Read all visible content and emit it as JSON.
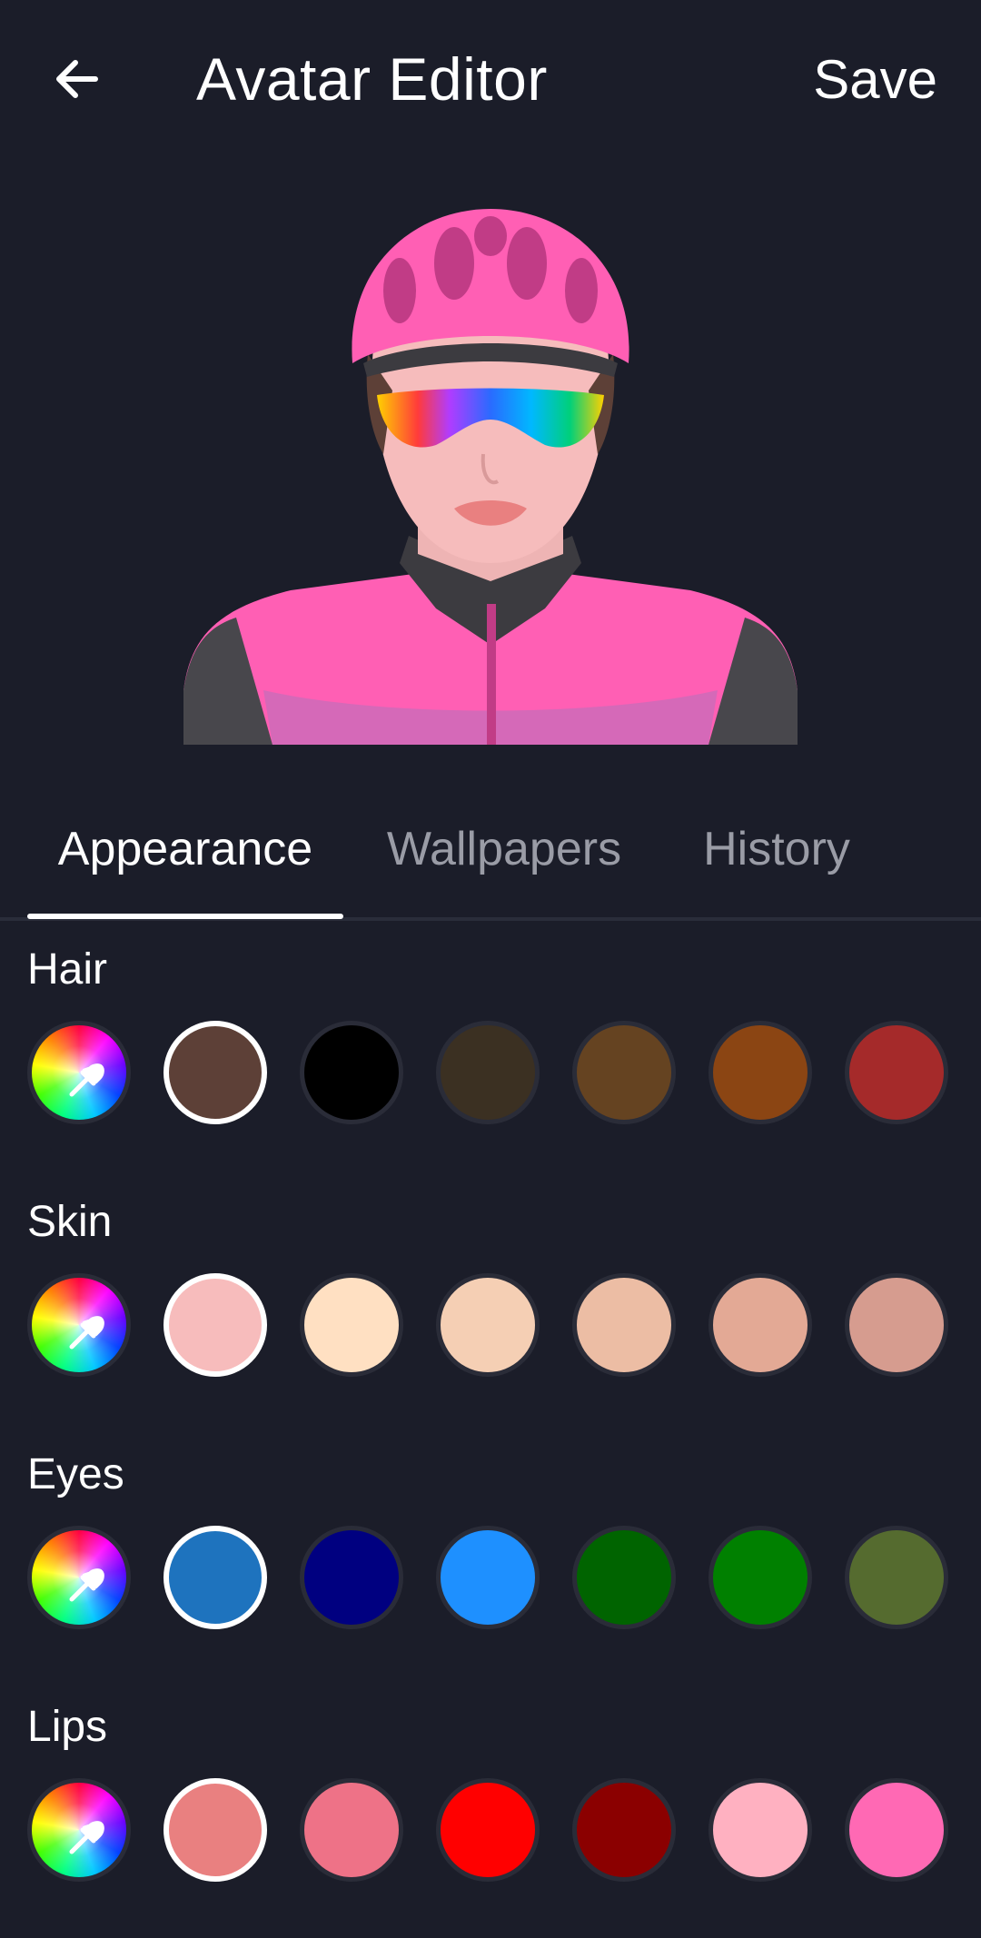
{
  "header": {
    "title": "Avatar Editor",
    "save_label": "Save",
    "back_icon": "arrow-left-icon"
  },
  "tabs": [
    {
      "label": "Appearance",
      "active": true
    },
    {
      "label": "Wallpapers",
      "active": false
    },
    {
      "label": "History",
      "active": false
    }
  ],
  "sections": [
    {
      "label": "Hair",
      "selected_index": 1,
      "colors": [
        "#5d4037",
        "#000000",
        "#3b3022",
        "#654321",
        "#8b4513",
        "#a52a2a"
      ]
    },
    {
      "label": "Skin",
      "selected_index": 1,
      "colors": [
        "#f7bcbc",
        "#ffe0c2",
        "#f5cfb4",
        "#ecbda4",
        "#e3a995",
        "#d69c8f"
      ]
    },
    {
      "label": "Eyes",
      "selected_index": 1,
      "colors": [
        "#1e73be",
        "#000080",
        "#1e90ff",
        "#006400",
        "#008000",
        "#556b2f"
      ]
    },
    {
      "label": "Lips",
      "selected_index": 1,
      "colors": [
        "#e98080",
        "#ee7287",
        "#ff0000",
        "#8b0000",
        "#ffb1c1",
        "#ff69b4"
      ]
    }
  ],
  "colors": {
    "background": "#1b1d29",
    "accent_pink": "#ff5fb4",
    "tab_inactive": "#9a9ca6"
  }
}
